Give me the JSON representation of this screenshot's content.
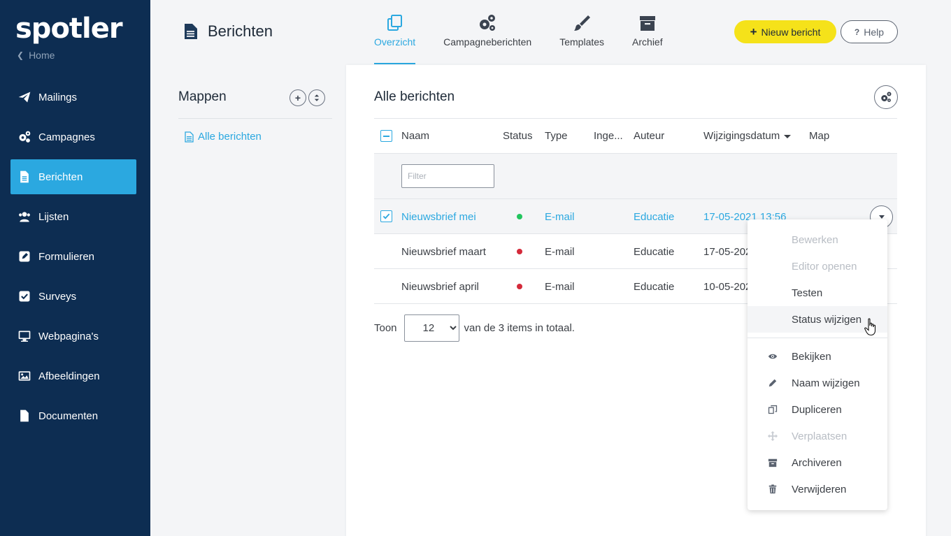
{
  "sidebar": {
    "logo": "spotler",
    "home_label": "Home",
    "items": [
      {
        "label": "Mailings",
        "icon": "paper-plane-icon"
      },
      {
        "label": "Campagnes",
        "icon": "cogs-icon"
      },
      {
        "label": "Berichten",
        "icon": "file-text-icon",
        "active": true
      },
      {
        "label": "Lijsten",
        "icon": "users-icon"
      },
      {
        "label": "Formulieren",
        "icon": "pencil-square-icon"
      },
      {
        "label": "Surveys",
        "icon": "check-square-icon"
      },
      {
        "label": "Webpagina's",
        "icon": "desktop-icon"
      },
      {
        "label": "Afbeeldingen",
        "icon": "image-icon"
      },
      {
        "label": "Documenten",
        "icon": "file-icon"
      }
    ]
  },
  "header": {
    "title": "Berichten",
    "tabs": [
      {
        "label": "Overzicht",
        "active": true
      },
      {
        "label": "Campagneberichten"
      },
      {
        "label": "Templates"
      },
      {
        "label": "Archief"
      }
    ],
    "new_button": "Nieuw bericht",
    "help_button": "Help"
  },
  "folders": {
    "title": "Mappen",
    "items": [
      "Alle berichten"
    ]
  },
  "main": {
    "title": "Alle berichten",
    "columns": [
      "Naam",
      "Status",
      "Type",
      "Inge...",
      "Auteur",
      "Wijzigingsdatum",
      "Map"
    ],
    "filter_placeholder": "Filter",
    "rows": [
      {
        "name": "Nieuwsbrief mei",
        "status": "green",
        "type": "E-mail",
        "author": "Educatie",
        "date": "17-05-2021 13:56",
        "selected": true
      },
      {
        "name": "Nieuwsbrief maart",
        "status": "red",
        "type": "E-mail",
        "author": "Educatie",
        "date": "17-05-202",
        "selected": false
      },
      {
        "name": "Nieuwsbrief april",
        "status": "red",
        "type": "E-mail",
        "author": "Educatie",
        "date": "10-05-202",
        "selected": false
      }
    ],
    "pager": {
      "prefix": "Toon",
      "page_size": "12",
      "suffix": "van de 3 items in totaal."
    }
  },
  "context_menu": {
    "items": [
      {
        "label": "Bewerken",
        "disabled": true
      },
      {
        "label": "Editor openen",
        "disabled": true
      },
      {
        "label": "Testen",
        "disabled": false
      },
      {
        "label": "Status wijzigen",
        "disabled": false,
        "hover": true
      },
      {
        "label": "Bekijken",
        "icon": "eye-icon"
      },
      {
        "label": "Naam wijzigen",
        "icon": "pencil-icon"
      },
      {
        "label": "Dupliceren",
        "icon": "copy-icon"
      },
      {
        "label": "Verplaatsen",
        "icon": "move-icon",
        "disabled": true
      },
      {
        "label": "Archiveren",
        "icon": "archive-icon"
      },
      {
        "label": "Verwijderen",
        "icon": "trash-icon"
      }
    ]
  },
  "colors": {
    "sidebar_bg": "#0d2d52",
    "accent": "#2ba8e0",
    "cta": "#f5e21a",
    "status_green": "#22c55e",
    "status_red": "#d42a3a"
  }
}
